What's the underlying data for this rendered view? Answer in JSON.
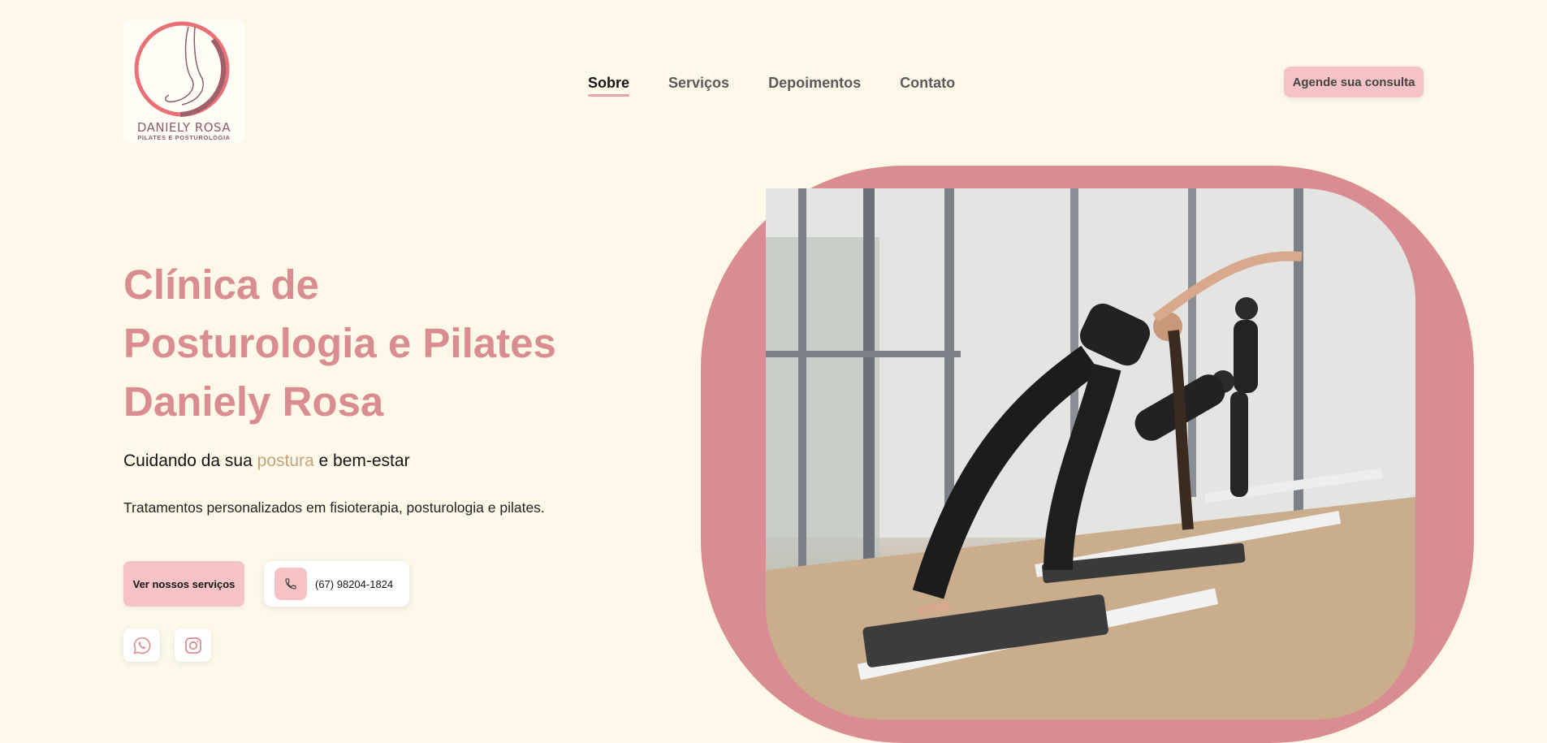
{
  "logo": {
    "name": "DANIELY ROSA",
    "subtitle": "PILATES E POSTUROLOGIA"
  },
  "nav": {
    "items": [
      {
        "label": "Sobre",
        "active": true
      },
      {
        "label": "Serviços",
        "active": false
      },
      {
        "label": "Depoimentos",
        "active": false
      },
      {
        "label": "Contato",
        "active": false
      }
    ]
  },
  "header": {
    "cta_label": "Agende sua consulta"
  },
  "hero": {
    "title_lines": [
      "Clínica de",
      "Posturologia e Pilates",
      "Daniely Rosa"
    ],
    "tagline_before": "Cuidando da sua ",
    "tagline_highlight": "postura",
    "tagline_after": " e bem-estar",
    "description": "Tratamentos personalizados em fisioterapia, posturologia e pilates.",
    "services_button": "Ver nossos serviços",
    "phone": "(67) 98204-1824",
    "social": [
      "whatsapp-icon",
      "instagram-icon"
    ]
  },
  "colors": {
    "background": "#fdf8e8",
    "accent": "#d98c92",
    "button": "#f5c3c5",
    "highlight": "#c4a57f"
  }
}
